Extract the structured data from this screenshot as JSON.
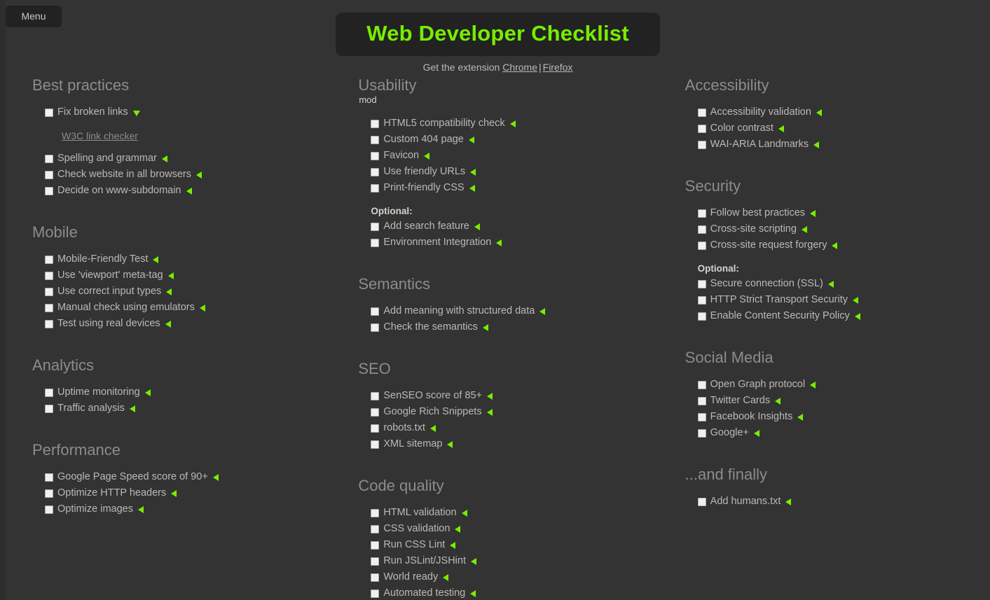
{
  "menu": {
    "label": "Menu"
  },
  "header": {
    "title": "Web Developer Checklist",
    "subtitle_prefix": "Get the extension",
    "chrome_link": "Chrome",
    "separator": "|",
    "firefox_link": "Firefox",
    "accent_color": "#76ee00",
    "title_box_bg": "#222222",
    "page_bg": "#333333"
  },
  "columns": [
    {
      "sections": [
        {
          "heading": "Best practices",
          "items": [
            {
              "label": "Fix broken links",
              "arrow": "down-triangle-icon",
              "expanded": true,
              "detail_link": "W3C link checker"
            },
            {
              "label": "Spelling and grammar",
              "arrow": "left-triangle-icon"
            },
            {
              "label": "Check website in all browsers",
              "arrow": "left-triangle-icon"
            },
            {
              "label": "Decide on www-subdomain",
              "arrow": "left-triangle-icon"
            }
          ]
        },
        {
          "heading": "Mobile",
          "items": [
            {
              "label": "Mobile-Friendly Test",
              "arrow": "left-triangle-icon"
            },
            {
              "label": "Use 'viewport' meta-tag",
              "arrow": "left-triangle-icon"
            },
            {
              "label": "Use correct input types",
              "arrow": "left-triangle-icon"
            },
            {
              "label": "Manual check using emulators",
              "arrow": "left-triangle-icon"
            },
            {
              "label": "Test using real devices",
              "arrow": "left-triangle-icon"
            }
          ]
        },
        {
          "heading": "Analytics",
          "items": [
            {
              "label": "Uptime monitoring",
              "arrow": "left-triangle-icon"
            },
            {
              "label": "Traffic analysis",
              "arrow": "left-triangle-icon"
            }
          ]
        },
        {
          "heading": "Performance",
          "items": [
            {
              "label": "Google Page Speed score of 90+",
              "arrow": "left-triangle-icon"
            },
            {
              "label": "Optimize HTTP headers",
              "arrow": "left-triangle-icon"
            },
            {
              "label": "Optimize images",
              "arrow": "left-triangle-icon"
            }
          ]
        }
      ]
    },
    {
      "sections": [
        {
          "heading": "Usability",
          "subheading": "mod",
          "items": [
            {
              "label": "HTML5 compatibility check",
              "arrow": "left-triangle-icon"
            },
            {
              "label": "Custom 404 page",
              "arrow": "left-triangle-icon"
            },
            {
              "label": "Favicon",
              "arrow": "left-triangle-icon"
            },
            {
              "label": "Use friendly URLs",
              "arrow": "left-triangle-icon"
            },
            {
              "label": "Print-friendly CSS",
              "arrow": "left-triangle-icon"
            }
          ],
          "optional_label": "Optional:",
          "optional_items": [
            {
              "label": "Add search feature",
              "arrow": "left-triangle-icon"
            },
            {
              "label": "Environment Integration",
              "arrow": "left-triangle-icon"
            }
          ]
        },
        {
          "heading": "Semantics",
          "items": [
            {
              "label": "Add meaning with structured data",
              "arrow": "left-triangle-icon"
            },
            {
              "label": "Check the semantics",
              "arrow": "left-triangle-icon"
            }
          ]
        },
        {
          "heading": "SEO",
          "items": [
            {
              "label": "SenSEO score of 85+",
              "arrow": "left-triangle-icon"
            },
            {
              "label": "Google Rich Snippets",
              "arrow": "left-triangle-icon"
            },
            {
              "label": "robots.txt",
              "arrow": "left-triangle-icon"
            },
            {
              "label": "XML sitemap",
              "arrow": "left-triangle-icon"
            }
          ]
        },
        {
          "heading": "Code quality",
          "items": [
            {
              "label": "HTML validation",
              "arrow": "left-triangle-icon"
            },
            {
              "label": "CSS validation",
              "arrow": "left-triangle-icon"
            },
            {
              "label": "Run CSS Lint",
              "arrow": "left-triangle-icon"
            },
            {
              "label": "Run JSLint/JSHint",
              "arrow": "left-triangle-icon"
            },
            {
              "label": "World ready",
              "arrow": "left-triangle-icon"
            },
            {
              "label": "Automated testing",
              "arrow": "left-triangle-icon"
            }
          ]
        }
      ]
    },
    {
      "sections": [
        {
          "heading": "Accessibility",
          "items": [
            {
              "label": "Accessibility validation",
              "arrow": "left-triangle-icon"
            },
            {
              "label": "Color contrast",
              "arrow": "left-triangle-icon"
            },
            {
              "label": "WAI-ARIA Landmarks",
              "arrow": "left-triangle-icon"
            }
          ]
        },
        {
          "heading": "Security",
          "items": [
            {
              "label": "Follow best practices",
              "arrow": "left-triangle-icon"
            },
            {
              "label": "Cross-site scripting",
              "arrow": "left-triangle-icon"
            },
            {
              "label": "Cross-site request forgery",
              "arrow": "left-triangle-icon"
            }
          ],
          "optional_label": "Optional:",
          "optional_items": [
            {
              "label": "Secure connection (SSL)",
              "arrow": "left-triangle-icon"
            },
            {
              "label": "HTTP Strict Transport Security",
              "arrow": "left-triangle-icon"
            },
            {
              "label": "Enable Content Security Policy",
              "arrow": "left-triangle-icon"
            }
          ]
        },
        {
          "heading": "Social Media",
          "items": [
            {
              "label": "Open Graph protocol",
              "arrow": "left-triangle-icon"
            },
            {
              "label": "Twitter Cards",
              "arrow": "left-triangle-icon"
            },
            {
              "label": "Facebook Insights",
              "arrow": "left-triangle-icon"
            },
            {
              "label": "Google+",
              "arrow": "left-triangle-icon"
            }
          ]
        },
        {
          "heading": "...and finally",
          "items": [
            {
              "label": "Add humans.txt",
              "arrow": "left-triangle-icon"
            }
          ]
        }
      ]
    }
  ]
}
